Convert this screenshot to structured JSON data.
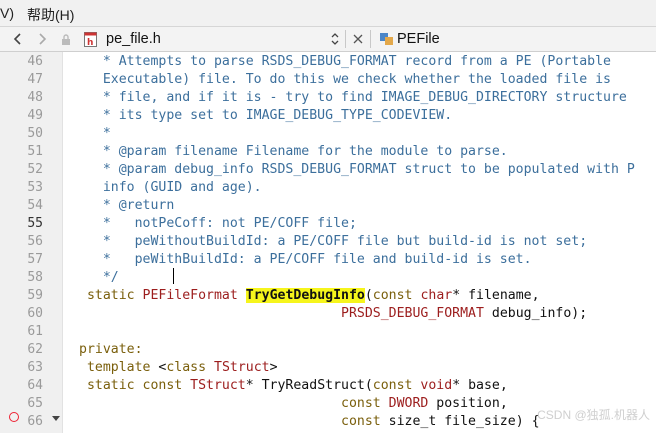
{
  "menubar": {
    "partial_item": "V)",
    "help_label": "帮助(H)"
  },
  "tabbar": {
    "file_tab": "pe_file.h",
    "class_tab": "PEFile"
  },
  "editor": {
    "current_line": "55",
    "lines": [
      {
        "n": "46",
        "segs": [
          [
            "cmt",
            "   * Attempts to parse RSDS_DEBUG_FORMAT record from a PE (Portable"
          ]
        ]
      },
      {
        "n": "47",
        "segs": [
          [
            "cmt",
            "   Executable) file. To do this we check whether the loaded file is"
          ]
        ]
      },
      {
        "n": "48",
        "segs": [
          [
            "cmt",
            "   * file, and if it is - try to find IMAGE_DEBUG_DIRECTORY structure"
          ]
        ]
      },
      {
        "n": "49",
        "segs": [
          [
            "cmt",
            "   * its type set to IMAGE_DEBUG_TYPE_CODEVIEW."
          ]
        ]
      },
      {
        "n": "50",
        "segs": [
          [
            "cmt",
            "   *"
          ]
        ]
      },
      {
        "n": "51",
        "segs": [
          [
            "cmt",
            "   * @param filename Filename for the module to parse."
          ]
        ]
      },
      {
        "n": "52",
        "segs": [
          [
            "cmt",
            "   * @param debug_info RSDS_DEBUG_FORMAT struct to be populated with P"
          ]
        ]
      },
      {
        "n": "53",
        "segs": [
          [
            "cmt",
            "   info (GUID and age)."
          ]
        ]
      },
      {
        "n": "54",
        "segs": [
          [
            "cmt",
            "   * @return"
          ]
        ]
      },
      {
        "n": "55",
        "segs": [
          [
            "cmt",
            "   *   notPeCoff: not PE/COFF file;"
          ]
        ]
      },
      {
        "n": "56",
        "segs": [
          [
            "cmt",
            "   *   peWithoutBuildId: a PE/COFF file but build-id is not set;"
          ]
        ]
      },
      {
        "n": "57",
        "segs": [
          [
            "cmt",
            "   *   peWithBuildId: a PE/COFF file and build-id is set."
          ]
        ]
      },
      {
        "n": "58",
        "segs": [
          [
            "cmt",
            "   */"
          ]
        ]
      },
      {
        "n": "59",
        "segs": [
          [
            "kw",
            " static "
          ],
          [
            "ty",
            "PEFileFormat "
          ],
          [
            "fn",
            "TryGetDebugInfo"
          ],
          [
            "tx",
            "("
          ],
          [
            "kw",
            "const "
          ],
          [
            "ty",
            "char"
          ],
          [
            "tx",
            "* filename,"
          ]
        ]
      },
      {
        "n": "60",
        "segs": [
          [
            "tx",
            "                                 "
          ],
          [
            "ty",
            "PRSDS_DEBUG_FORMAT "
          ],
          [
            "tx",
            "debug_info);"
          ]
        ]
      },
      {
        "n": "61",
        "segs": [
          [
            "tx",
            ""
          ]
        ]
      },
      {
        "n": "62",
        "segs": [
          [
            "kw",
            "private:"
          ]
        ]
      },
      {
        "n": "63",
        "segs": [
          [
            "kw",
            " template "
          ],
          [
            "tx",
            "<"
          ],
          [
            "kw",
            "class "
          ],
          [
            "ty",
            "TStruct"
          ],
          [
            "tx",
            ">"
          ]
        ]
      },
      {
        "n": "64",
        "segs": [
          [
            "kw",
            " static const "
          ],
          [
            "ty",
            "TStruct"
          ],
          [
            "tx",
            "* TryReadStruct("
          ],
          [
            "kw",
            "const "
          ],
          [
            "ty",
            "void"
          ],
          [
            "tx",
            "* base,"
          ]
        ]
      },
      {
        "n": "65",
        "segs": [
          [
            "tx",
            "                                 "
          ],
          [
            "kw",
            "const "
          ],
          [
            "ty",
            "DWORD "
          ],
          [
            "tx",
            "position,"
          ]
        ]
      },
      {
        "n": "66",
        "segs": [
          [
            "tx",
            "                                 "
          ],
          [
            "kw",
            "const "
          ],
          [
            "tx",
            "size_t file_size) {"
          ]
        ]
      }
    ]
  },
  "watermark": "CSDN @独孤.机器人"
}
